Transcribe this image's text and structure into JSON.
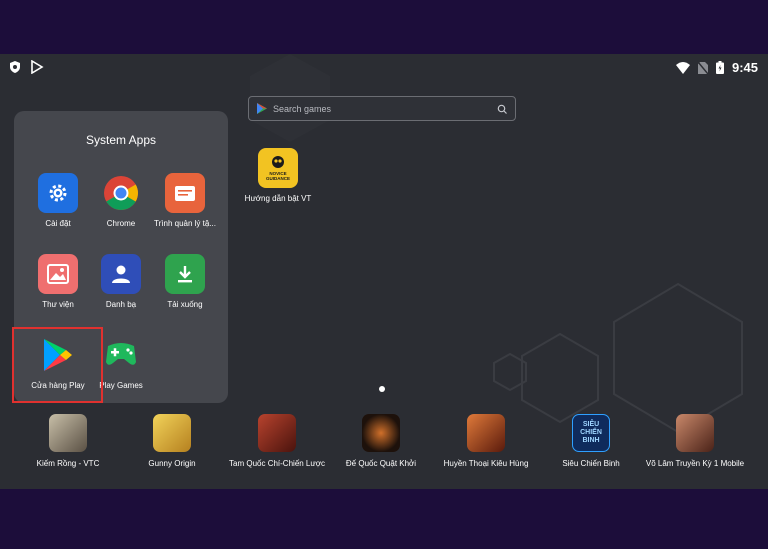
{
  "status_bar": {
    "time": "9:45"
  },
  "search": {
    "placeholder": "Search games"
  },
  "folder": {
    "title": "System Apps",
    "apps": [
      {
        "label": "Cài đặt",
        "icon": "gear-icon"
      },
      {
        "label": "Chrome",
        "icon": "chrome-icon"
      },
      {
        "label": "Trình quản lý tậ...",
        "icon": "file-manager-icon"
      },
      {
        "label": "Thư viện",
        "icon": "gallery-icon"
      },
      {
        "label": "Danh bạ",
        "icon": "contacts-icon"
      },
      {
        "label": "Tải xuống",
        "icon": "download-icon"
      },
      {
        "label": "Cửa hàng Play",
        "icon": "play-store-icon"
      },
      {
        "label": "Play Games",
        "icon": "play-games-icon"
      }
    ]
  },
  "desktop_app": {
    "label": "Hướng dẫn bật VT",
    "badge_line1": "NOVICE",
    "badge_line2": "GUIDANCE"
  },
  "dock": [
    {
      "label": "Kiếm Rồng - VTC",
      "color": "#8a7d6a"
    },
    {
      "label": "Gunny Origin",
      "color": "#d2a233"
    },
    {
      "label": "Tam Quốc Chí-Chiến Lược",
      "color": "#8a2a1f"
    },
    {
      "label": "Đế Quốc Quật Khởi",
      "color": "#3a2418"
    },
    {
      "label": "Huyền Thoại Kiêu Hùng",
      "color": "#a8401c"
    },
    {
      "label": "Siêu Chiến Binh",
      "color": "#0f2b5c",
      "badge_line1": "SIÊU",
      "badge_line2": "CHIẾN",
      "badge_line3": "BINH"
    },
    {
      "label": "Võ Lâm Truyền Kỳ 1 Mobile",
      "color": "#6b3a2a"
    }
  ],
  "colors": {
    "highlight": "#e0312f",
    "background": "#2b2d33",
    "folder": "#45474d",
    "outer": "#1c0d3a"
  }
}
